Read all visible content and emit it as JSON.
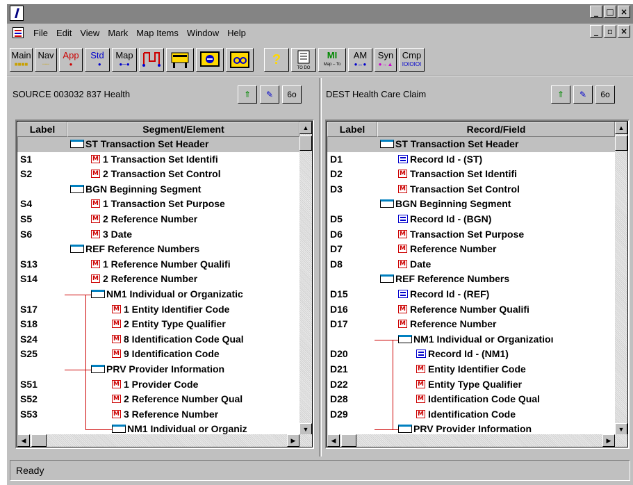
{
  "menu": {
    "items": [
      "File",
      "Edit",
      "View",
      "Mark",
      "Map Items",
      "Window",
      "Help"
    ]
  },
  "window_controls": {
    "minimize": "_",
    "restore": "□",
    "close": "×"
  },
  "doc_controls": {
    "minimize": "_",
    "restore": "▫",
    "close": "×"
  },
  "toolbar": {
    "main": "Main",
    "nav": "Nav",
    "app": "App",
    "std": "Std",
    "map": "Map",
    "mi": "MI",
    "mi_sub": "Map – To",
    "am": "AM",
    "syn": "Syn",
    "cmp": "Cmp",
    "todo_sub": "TO DO"
  },
  "source": {
    "title": "SOURCE 003032 837 Health",
    "col_label": "Label",
    "col_element": "Segment/Element",
    "rows": [
      {
        "label": "",
        "text": "ST  Transaction Set Header",
        "kind": "seg",
        "indent": 0
      },
      {
        "label": "S1",
        "text": "1  Transaction Set Identifi",
        "kind": "m",
        "indent": 1
      },
      {
        "label": "S2",
        "text": "2  Transaction Set Control",
        "kind": "m",
        "indent": 1
      },
      {
        "label": "",
        "text": "BGN  Beginning Segment",
        "kind": "seg",
        "indent": 0
      },
      {
        "label": "S4",
        "text": "1  Transaction Set Purpose",
        "kind": "m",
        "indent": 1
      },
      {
        "label": "S5",
        "text": "2  Reference Number",
        "kind": "m",
        "indent": 1
      },
      {
        "label": "S6",
        "text": "3  Date",
        "kind": "m",
        "indent": 1
      },
      {
        "label": "",
        "text": "REF  Reference Numbers",
        "kind": "seg",
        "indent": 0
      },
      {
        "label": "S13",
        "text": "1  Reference Number Qualifi",
        "kind": "m",
        "indent": 1
      },
      {
        "label": "S14",
        "text": "2  Reference Number",
        "kind": "m",
        "indent": 1
      },
      {
        "label": "",
        "text": "NM1  Individual or Organizatic",
        "kind": "seg",
        "indent": 1
      },
      {
        "label": "S17",
        "text": "1  Entity Identifier Code",
        "kind": "m",
        "indent": 2
      },
      {
        "label": "S18",
        "text": "2  Entity Type Qualifier",
        "kind": "m",
        "indent": 2
      },
      {
        "label": "S24",
        "text": "8  Identification Code Qual",
        "kind": "m",
        "indent": 2
      },
      {
        "label": "S25",
        "text": "9  Identification Code",
        "kind": "m",
        "indent": 2
      },
      {
        "label": "",
        "text": "PRV  Provider Information",
        "kind": "seg",
        "indent": 1
      },
      {
        "label": "S51",
        "text": "1  Provider Code",
        "kind": "m",
        "indent": 2
      },
      {
        "label": "S52",
        "text": "2  Reference Number Qual",
        "kind": "m",
        "indent": 2
      },
      {
        "label": "S53",
        "text": "3  Reference Number",
        "kind": "m",
        "indent": 2
      },
      {
        "label": "",
        "text": "NM1  Individual or Organiz",
        "kind": "seg",
        "indent": 2
      }
    ]
  },
  "dest": {
    "title": "DEST  Health Care Claim",
    "col_label": "Label",
    "col_field": "Record/Field",
    "rows": [
      {
        "label": "",
        "text": "ST  Transaction Set Header",
        "kind": "seg",
        "indent": 0
      },
      {
        "label": "D1",
        "text": "Record Id - (ST)",
        "kind": "rec",
        "indent": 1
      },
      {
        "label": "D2",
        "text": "Transaction Set Identifi",
        "kind": "m",
        "indent": 1
      },
      {
        "label": "D3",
        "text": "Transaction Set Control",
        "kind": "m",
        "indent": 1
      },
      {
        "label": "",
        "text": "BGN  Beginning Segment",
        "kind": "seg",
        "indent": 0
      },
      {
        "label": "D5",
        "text": "Record Id - (BGN)",
        "kind": "rec",
        "indent": 1
      },
      {
        "label": "D6",
        "text": "Transaction Set Purpose",
        "kind": "m",
        "indent": 1
      },
      {
        "label": "D7",
        "text": "Reference Number",
        "kind": "m",
        "indent": 1
      },
      {
        "label": "D8",
        "text": "Date",
        "kind": "m",
        "indent": 1
      },
      {
        "label": "",
        "text": "REF  Reference Numbers",
        "kind": "seg",
        "indent": 0
      },
      {
        "label": "D15",
        "text": "Record Id - (REF)",
        "kind": "rec",
        "indent": 1
      },
      {
        "label": "D16",
        "text": "Reference Number Qualifi",
        "kind": "m",
        "indent": 1
      },
      {
        "label": "D17",
        "text": "Reference Number",
        "kind": "m",
        "indent": 1
      },
      {
        "label": "",
        "text": "NM1  Individual or Organizatioı",
        "kind": "seg",
        "indent": 1
      },
      {
        "label": "D20",
        "text": "Record Id - (NM1)",
        "kind": "rec",
        "indent": 2
      },
      {
        "label": "D21",
        "text": "Entity Identifier Code",
        "kind": "m",
        "indent": 2
      },
      {
        "label": "D22",
        "text": "Entity Type Qualifier",
        "kind": "m",
        "indent": 2
      },
      {
        "label": "D28",
        "text": "Identification Code Qual",
        "kind": "m",
        "indent": 2
      },
      {
        "label": "D29",
        "text": "Identification Code",
        "kind": "m",
        "indent": 2
      },
      {
        "label": "",
        "text": "PRV  Provider Information",
        "kind": "seg",
        "indent": 1
      }
    ]
  },
  "status": {
    "text": "Ready"
  },
  "colors": {
    "window_bg": "#c0c0c0",
    "title_bar": "#848484",
    "tree_line": "#cc0000",
    "icon_blue": "#0000cc"
  }
}
